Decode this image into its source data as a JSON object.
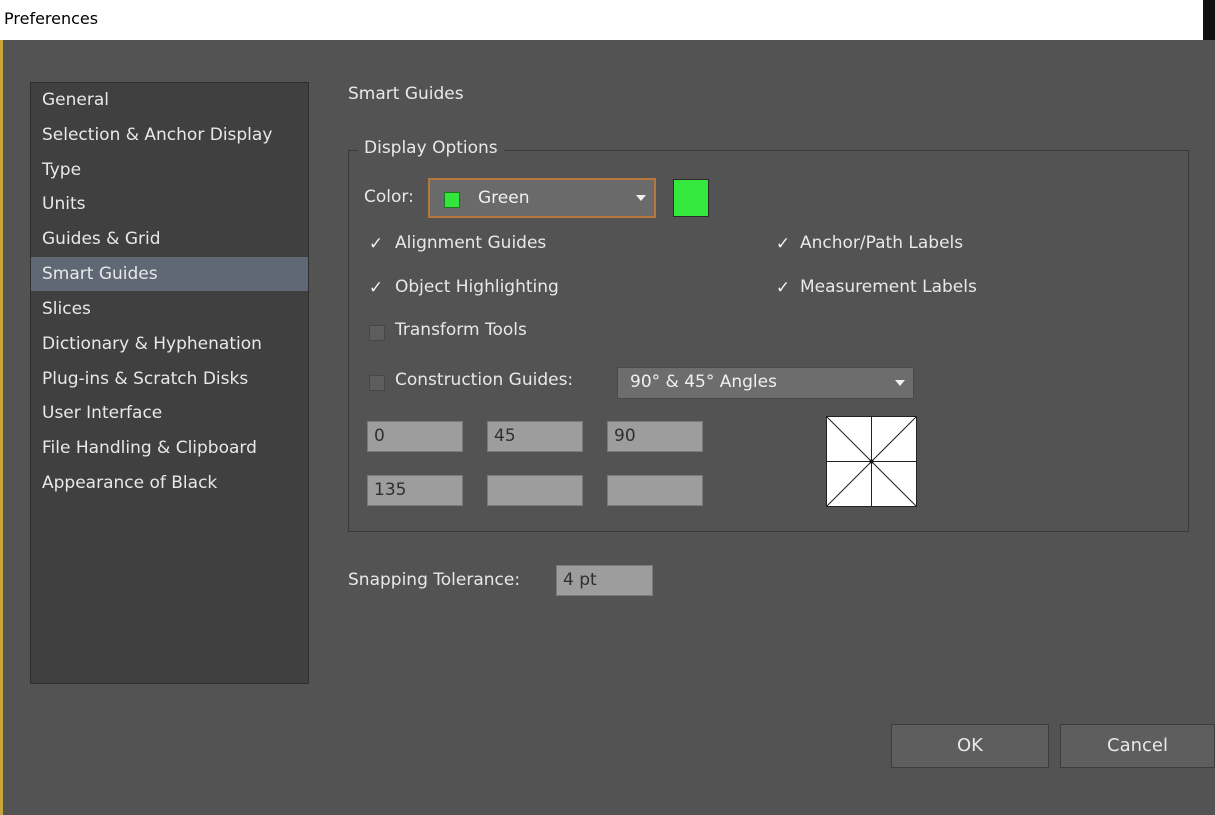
{
  "window": {
    "title": "Preferences"
  },
  "sidebar": {
    "items": [
      {
        "label": "General",
        "selected": false
      },
      {
        "label": "Selection & Anchor Display",
        "selected": false
      },
      {
        "label": "Type",
        "selected": false
      },
      {
        "label": "Units",
        "selected": false
      },
      {
        "label": "Guides & Grid",
        "selected": false
      },
      {
        "label": "Smart Guides",
        "selected": true
      },
      {
        "label": "Slices",
        "selected": false
      },
      {
        "label": "Dictionary & Hyphenation",
        "selected": false
      },
      {
        "label": "Plug-ins & Scratch Disks",
        "selected": false
      },
      {
        "label": "User Interface",
        "selected": false
      },
      {
        "label": "File Handling & Clipboard",
        "selected": false
      },
      {
        "label": "Appearance of Black",
        "selected": false
      }
    ]
  },
  "section_title": "Smart Guides",
  "display_options": {
    "group_label": "Display Options",
    "color_label": "Color:",
    "color_value": "Green",
    "color_hex": "#35e83d",
    "alignment_guides": {
      "label": "Alignment Guides",
      "checked": true
    },
    "anchor_path_labels": {
      "label": "Anchor/Path Labels",
      "checked": true
    },
    "object_highlighting": {
      "label": "Object Highlighting",
      "checked": true
    },
    "measurement_labels": {
      "label": "Measurement Labels",
      "checked": true
    },
    "transform_tools": {
      "label": "Transform Tools",
      "checked": false
    },
    "construction_guides": {
      "label": "Construction Guides:",
      "checked": false,
      "value": "90° & 45° Angles"
    },
    "angles": [
      "0",
      "45",
      "90",
      "135",
      "",
      ""
    ]
  },
  "snapping": {
    "label": "Snapping Tolerance:",
    "value": "4 pt"
  },
  "buttons": {
    "ok": "OK",
    "cancel": "Cancel"
  },
  "check_glyph": "✓"
}
